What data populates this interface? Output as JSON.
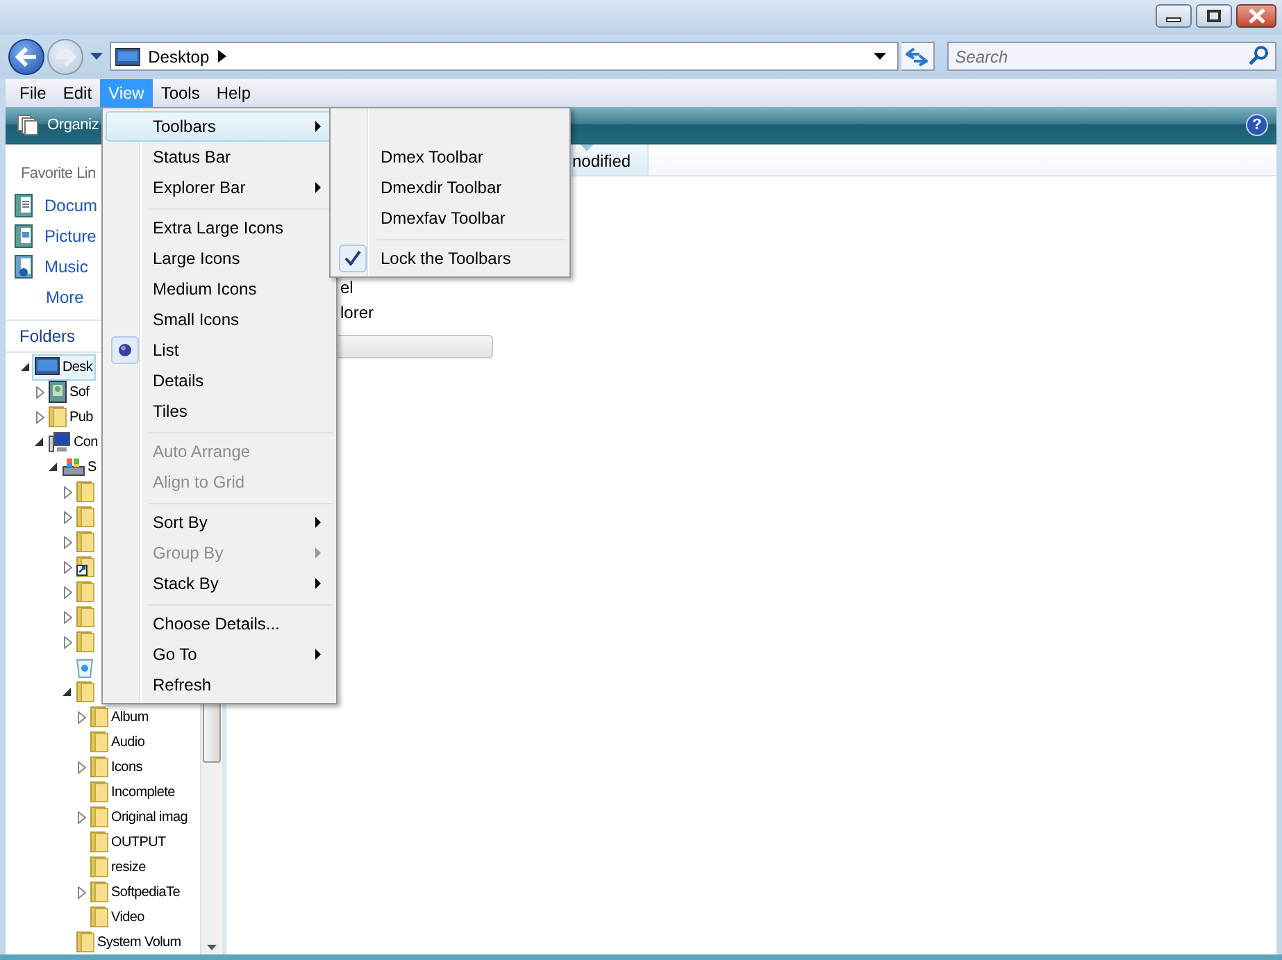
{
  "address_bar": {
    "location": "Desktop"
  },
  "search": {
    "placeholder": "Search"
  },
  "menu_bar": [
    {
      "label": "File",
      "selected": false
    },
    {
      "label": "Edit",
      "selected": false
    },
    {
      "label": "View",
      "selected": true
    },
    {
      "label": "Tools",
      "selected": false
    },
    {
      "label": "Help",
      "selected": false
    }
  ],
  "command_bar": {
    "organize": "Organiz",
    "help": "?"
  },
  "favorite_links": {
    "heading": "Favorite Lin",
    "items": [
      {
        "label": "Docum",
        "kind": "documents"
      },
      {
        "label": "Picture",
        "kind": "pictures"
      },
      {
        "label": "Music",
        "kind": "music"
      }
    ],
    "more": "More"
  },
  "folders": {
    "heading": "Folders",
    "tree": [
      {
        "label": "Desk",
        "kind": "desktop",
        "has_children": true,
        "expanded": true,
        "selected": true,
        "children": [
          {
            "label": "Sof",
            "kind": "contacts",
            "has_children": true,
            "expanded": false,
            "selected": false
          },
          {
            "label": "Pub",
            "kind": "folder",
            "has_children": true,
            "expanded": false,
            "selected": false
          },
          {
            "label": "Con",
            "kind": "computer",
            "has_children": true,
            "expanded": true,
            "selected": false,
            "children": [
              {
                "label": "S",
                "kind": "drive",
                "has_children": true,
                "expanded": true,
                "selected": false,
                "children": [
                  {
                    "kind": "folder",
                    "has_children": true,
                    "expanded": false,
                    "selected": false
                  },
                  {
                    "kind": "folder",
                    "has_children": true,
                    "expanded": false,
                    "selected": false
                  },
                  {
                    "kind": "folder",
                    "has_children": true,
                    "expanded": false,
                    "selected": false
                  },
                  {
                    "kind": "shortcut",
                    "has_children": true,
                    "expanded": false,
                    "selected": false
                  },
                  {
                    "kind": "folder",
                    "has_children": true,
                    "expanded": false,
                    "selected": false
                  },
                  {
                    "kind": "folder",
                    "has_children": true,
                    "expanded": false,
                    "selected": false
                  },
                  {
                    "kind": "folder",
                    "has_children": true,
                    "expanded": false,
                    "selected": false
                  },
                  {
                    "kind": "recycle",
                    "has_children": false,
                    "selected": false
                  },
                  {
                    "kind": "folder",
                    "has_children": true,
                    "expanded": true,
                    "selected": false,
                    "children": [
                      {
                        "label": "Album",
                        "kind": "folder",
                        "has_children": true,
                        "expanded": false,
                        "selected": false
                      },
                      {
                        "label": "Audio",
                        "kind": "folder",
                        "has_children": false,
                        "selected": false
                      },
                      {
                        "label": "Icons",
                        "kind": "folder",
                        "has_children": true,
                        "expanded": false,
                        "selected": false
                      },
                      {
                        "label": "Incomplete",
                        "kind": "folder",
                        "has_children": false,
                        "selected": false
                      },
                      {
                        "label": "Original imag",
                        "kind": "folder",
                        "has_children": true,
                        "expanded": false,
                        "selected": false
                      },
                      {
                        "label": "OUTPUT",
                        "kind": "folder",
                        "has_children": false,
                        "selected": false
                      },
                      {
                        "label": "resize",
                        "kind": "folder",
                        "has_children": false,
                        "selected": false
                      },
                      {
                        "label": "SoftpediaTe",
                        "kind": "folder",
                        "has_children": true,
                        "expanded": false,
                        "selected": false
                      },
                      {
                        "label": "Video",
                        "kind": "folder",
                        "has_children": false,
                        "selected": false
                      }
                    ]
                  },
                  {
                    "label": "System Volum",
                    "kind": "folder",
                    "has_children": false,
                    "selected": false
                  }
                ]
              }
            ]
          }
        ]
      }
    ]
  },
  "file_list": {
    "columns": [
      {
        "label": "nodified",
        "sorted": true
      }
    ],
    "items": [
      {
        "label": "el"
      },
      {
        "label": "lorer"
      }
    ]
  },
  "view_menu": {
    "groups": [
      {
        "items": [
          {
            "label": "Toolbars",
            "selected": true,
            "disabled": false,
            "checked": false,
            "submenu": true
          },
          {
            "label": "Status Bar",
            "selected": false,
            "disabled": false,
            "checked": false,
            "submenu": false
          },
          {
            "label": "Explorer Bar",
            "selected": false,
            "disabled": false,
            "checked": false,
            "submenu": true
          }
        ]
      },
      {
        "kind": "radio",
        "items": [
          {
            "label": "Extra Large Icons",
            "selected": false,
            "disabled": false,
            "checked": false,
            "submenu": false
          },
          {
            "label": "Large Icons",
            "selected": false,
            "disabled": false,
            "checked": false,
            "submenu": false
          },
          {
            "label": "Medium Icons",
            "selected": false,
            "disabled": false,
            "checked": false,
            "submenu": false
          },
          {
            "label": "Small Icons",
            "selected": false,
            "disabled": false,
            "checked": false,
            "submenu": false
          },
          {
            "label": "List",
            "selected": false,
            "disabled": false,
            "checked": true,
            "submenu": false
          },
          {
            "label": "Details",
            "selected": false,
            "disabled": false,
            "checked": false,
            "submenu": false
          },
          {
            "label": "Tiles",
            "selected": false,
            "disabled": false,
            "checked": false,
            "submenu": false
          }
        ]
      },
      {
        "items": [
          {
            "label": "Auto Arrange",
            "selected": false,
            "disabled": true,
            "checked": false,
            "submenu": false
          },
          {
            "label": "Align to Grid",
            "selected": false,
            "disabled": true,
            "checked": false,
            "submenu": false
          }
        ]
      },
      {
        "items": [
          {
            "label": "Sort By",
            "selected": false,
            "disabled": false,
            "checked": false,
            "submenu": true
          },
          {
            "label": "Group By",
            "selected": false,
            "disabled": true,
            "checked": false,
            "submenu": true
          },
          {
            "label": "Stack By",
            "selected": false,
            "disabled": false,
            "checked": false,
            "submenu": true
          }
        ]
      },
      {
        "items": [
          {
            "label": "Choose Details...",
            "selected": false,
            "disabled": false,
            "checked": false,
            "submenu": false
          },
          {
            "label": "Go To",
            "selected": false,
            "disabled": false,
            "checked": false,
            "submenu": true
          },
          {
            "label": "Refresh",
            "selected": false,
            "disabled": false,
            "checked": false,
            "submenu": false
          }
        ]
      }
    ]
  },
  "toolbars_submenu": {
    "groups": [
      {
        "items": [
          {
            "label": "Dmex Toolbar",
            "selected": false,
            "disabled": false,
            "checked": false,
            "submenu": false
          },
          {
            "label": "Dmexdir Toolbar",
            "selected": false,
            "disabled": false,
            "checked": false,
            "submenu": false
          },
          {
            "label": "Dmexfav Toolbar",
            "selected": false,
            "disabled": false,
            "checked": false,
            "submenu": false
          }
        ]
      },
      {
        "kind": "check",
        "items": [
          {
            "label": "Lock the Toolbars",
            "selected": false,
            "disabled": false,
            "checked": true,
            "submenu": false
          }
        ]
      }
    ]
  }
}
